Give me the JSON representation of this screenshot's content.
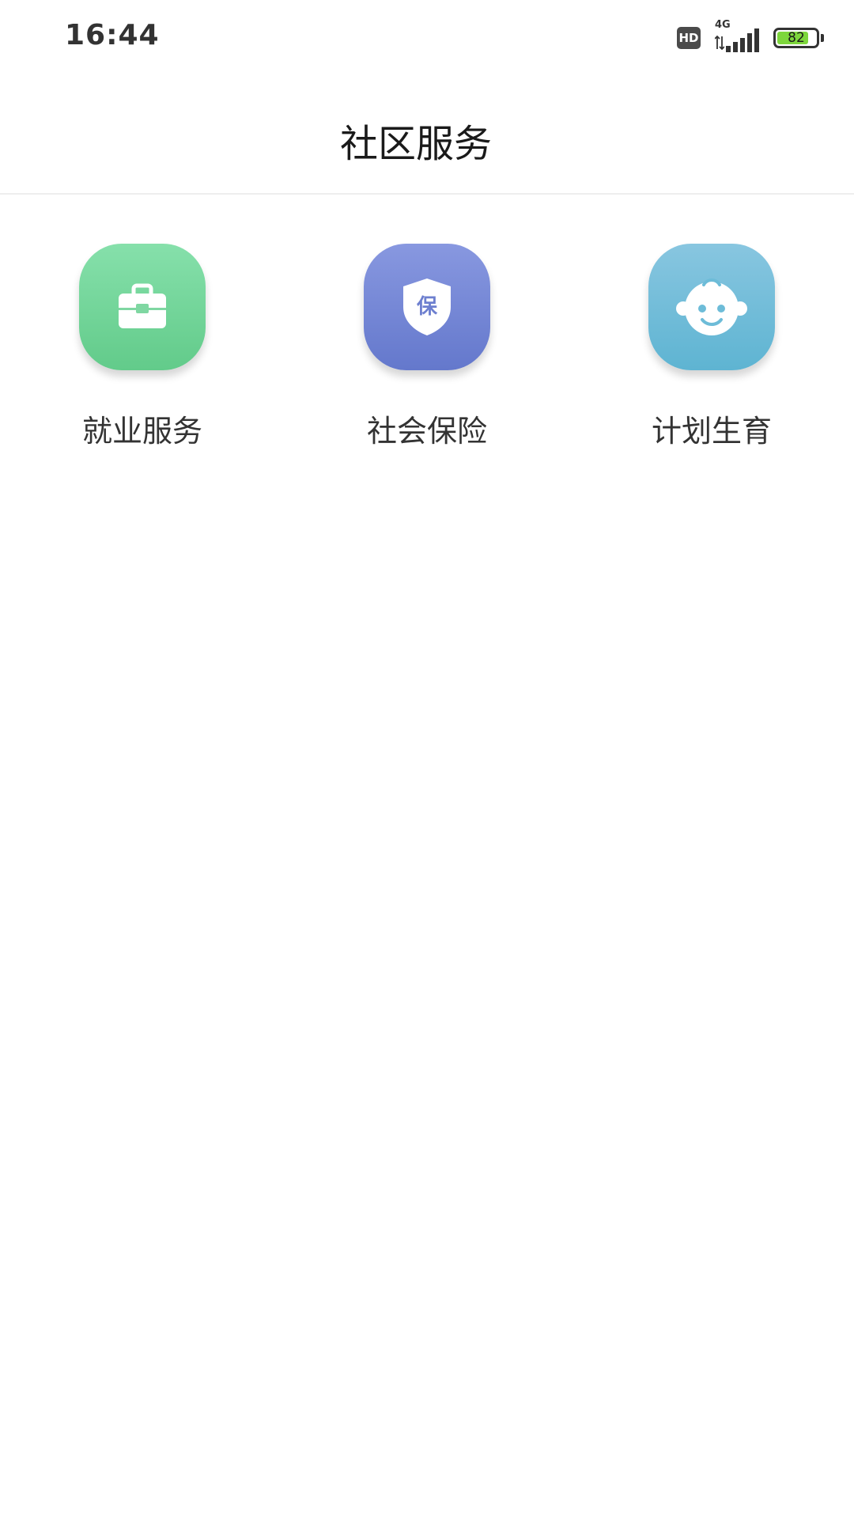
{
  "status_bar": {
    "time": "16:44",
    "hd_label": "HD",
    "network_label": "4G",
    "battery_level": "82",
    "battery_fill_color": "#7dd63c"
  },
  "header": {
    "title": "社区服务"
  },
  "services": [
    {
      "label": "就业服务",
      "icon": "briefcase-icon",
      "color": "#6dd497"
    },
    {
      "label": "社会保险",
      "icon": "shield-icon",
      "color": "#7284d4",
      "icon_text": "保"
    },
    {
      "label": "计划生育",
      "icon": "baby-face-icon",
      "color": "#6dbcd8"
    }
  ]
}
